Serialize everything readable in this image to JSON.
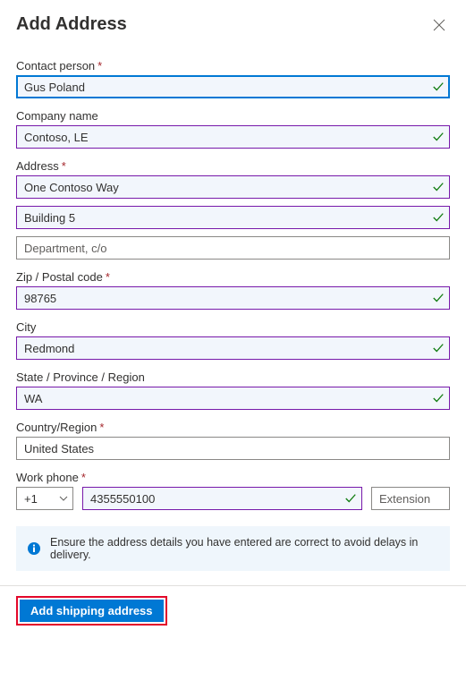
{
  "header": {
    "title": "Add Address"
  },
  "fields": {
    "contact_label": "Contact person",
    "contact_value": "Gus Poland",
    "company_label": "Company name",
    "company_value": "Contoso, LE",
    "address_label": "Address",
    "address_line1": "One Contoso Way",
    "address_line2": "Building 5",
    "address_line3_placeholder": "Department, c/o",
    "zip_label": "Zip / Postal code",
    "zip_value": "98765",
    "city_label": "City",
    "city_value": "Redmond",
    "state_label": "State / Province / Region",
    "state_value": "WA",
    "country_label": "Country/Region",
    "country_value": "United States",
    "phone_label": "Work phone",
    "phone_code": "+1",
    "phone_value": "4355550100",
    "phone_ext_placeholder": "Extension"
  },
  "info": {
    "text": "Ensure the address details you have entered are correct to avoid delays in delivery."
  },
  "footer": {
    "submit_label": "Add shipping address"
  }
}
